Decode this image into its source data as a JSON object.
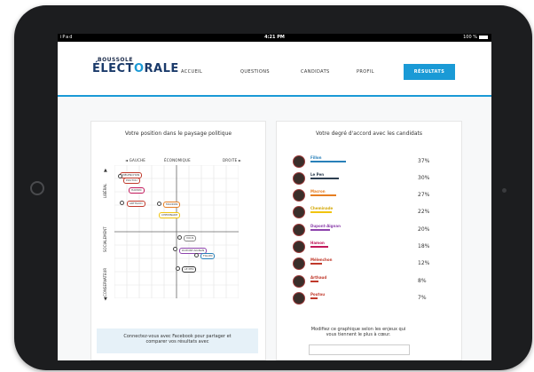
{
  "status_bar": {
    "carrier": "iPad",
    "time": "4:21 PM",
    "battery": "100 %"
  },
  "logo": {
    "line1": "BOUSSOLE",
    "line2_a": "ÉLECT",
    "line2_o": "O",
    "line2_b": "RALE"
  },
  "nav": {
    "items": [
      {
        "label": "ACCUEIL"
      },
      {
        "label": "QUESTIONS"
      },
      {
        "label": "CANDIDATS"
      },
      {
        "label": "PROFIL"
      },
      {
        "label": "RÉSULTATS"
      }
    ],
    "active_color": "#1a9ad6"
  },
  "left_panel": {
    "title": "Votre position dans le paysage politique",
    "axis": {
      "gauche": "◄  GAUCHE",
      "economique": "ÉCONOMIQUE",
      "droite": "DROITE  ►"
    },
    "vertical": {
      "liberal": "LIBÉRAL",
      "socialement": "SOCIALEMENT",
      "conservateur": "CONSERVATEUR"
    },
    "arrow_up": "▲",
    "arrow_down": "▼",
    "candidates": [
      {
        "label": "MÉLENCHON",
        "color": "#c0392b"
      },
      {
        "label": "POUTOU",
        "color": "#c0392b"
      },
      {
        "label": "HAMON",
        "color": "#c2185b"
      },
      {
        "label": "ARTHAUD",
        "color": "#c0392b"
      },
      {
        "label": "MACRON",
        "color": "#e67e22"
      },
      {
        "label": "CHEMINADE",
        "color": "#f1c40f"
      },
      {
        "label": "VOUS",
        "color": "#888888"
      },
      {
        "label": "DUPONT-AIGNAN",
        "color": "#8e44ad"
      },
      {
        "label": "FILLON",
        "color": "#2980b9"
      },
      {
        "label": "LE PEN",
        "color": "#333333"
      }
    ],
    "facebook": "Connectez-vous avec Facebook pour partager et comparer vos résultats avec"
  },
  "right_panel": {
    "title": "Votre degré d'accord avec les candidats",
    "candidates": [
      {
        "name": "Fillon",
        "pct": "37%",
        "color": "#2980b9",
        "value": 37
      },
      {
        "name": "Le Pen",
        "pct": "30%",
        "color": "#2c3e50",
        "value": 30
      },
      {
        "name": "Macron",
        "pct": "27%",
        "color": "#e67e22",
        "value": 27
      },
      {
        "name": "Cheminade",
        "pct": "22%",
        "color": "#f1c40f",
        "value": 22
      },
      {
        "name": "Dupont-Aignan",
        "pct": "20%",
        "color": "#8e44ad",
        "value": 20
      },
      {
        "name": "Hamon",
        "pct": "18%",
        "color": "#c2185b",
        "value": 18
      },
      {
        "name": "Mélenchon",
        "pct": "12%",
        "color": "#c0392b",
        "value": 12
      },
      {
        "name": "Arthaud",
        "pct": "8%",
        "color": "#c0392b",
        "value": 8
      },
      {
        "name": "Poutou",
        "pct": "7%",
        "color": "#c0392b",
        "value": 7
      }
    ],
    "note": "Modifiez ce graphique selon les enjeux qui vous tiennent le plus à cœur."
  }
}
